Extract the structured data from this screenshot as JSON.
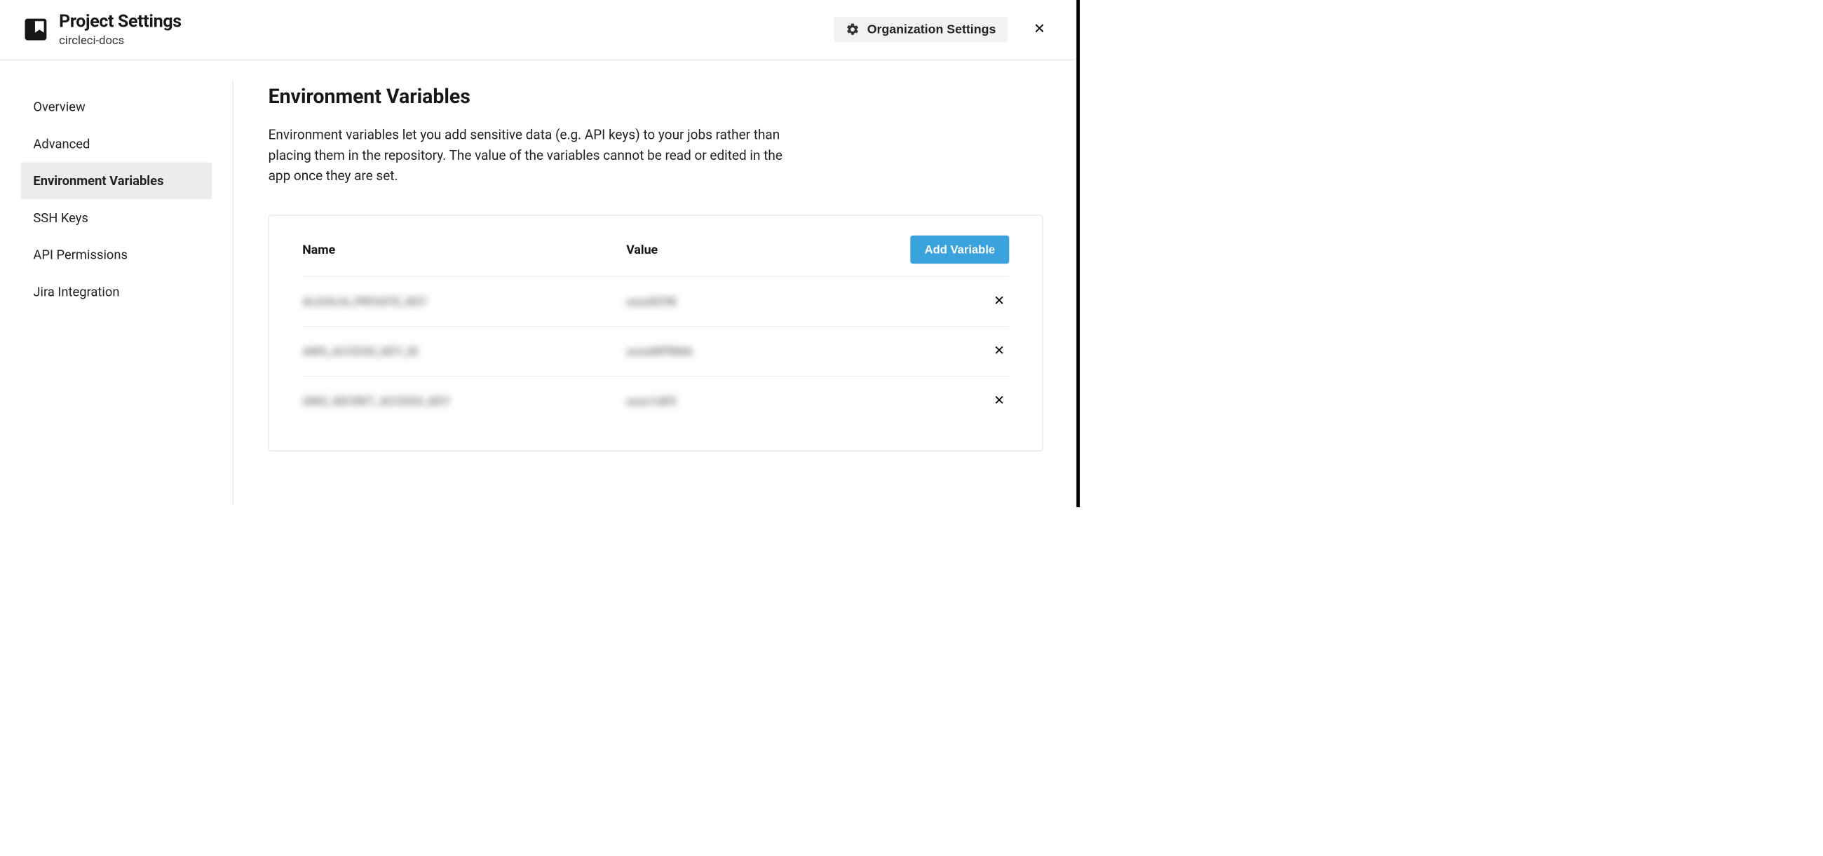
{
  "header": {
    "title": "Project Settings",
    "subtitle": "circleci-docs",
    "org_button": "Organization Settings"
  },
  "sidebar": {
    "items": [
      {
        "label": "Overview",
        "active": false
      },
      {
        "label": "Advanced",
        "active": false
      },
      {
        "label": "Environment Variables",
        "active": true
      },
      {
        "label": "SSH Keys",
        "active": false
      },
      {
        "label": "API Permissions",
        "active": false
      },
      {
        "label": "Jira Integration",
        "active": false
      }
    ]
  },
  "main": {
    "heading": "Environment Variables",
    "description": "Environment variables let you add sensitive data (e.g. API keys) to your jobs rather than placing them in the repository. The value of the variables cannot be read or edited in the app once they are set.",
    "table": {
      "col_name": "Name",
      "col_value": "Value",
      "add_button": "Add Variable",
      "rows": [
        {
          "name": "ALGOLIA_PRIVATE_KEY",
          "value": "xxxx8298"
        },
        {
          "name": "AWS_ACCESS_KEY_ID",
          "value": "xxxxMPRMA"
        },
        {
          "name": "AWS_SECRET_ACCESS_KEY",
          "value": "xxxx1d05"
        }
      ]
    }
  }
}
